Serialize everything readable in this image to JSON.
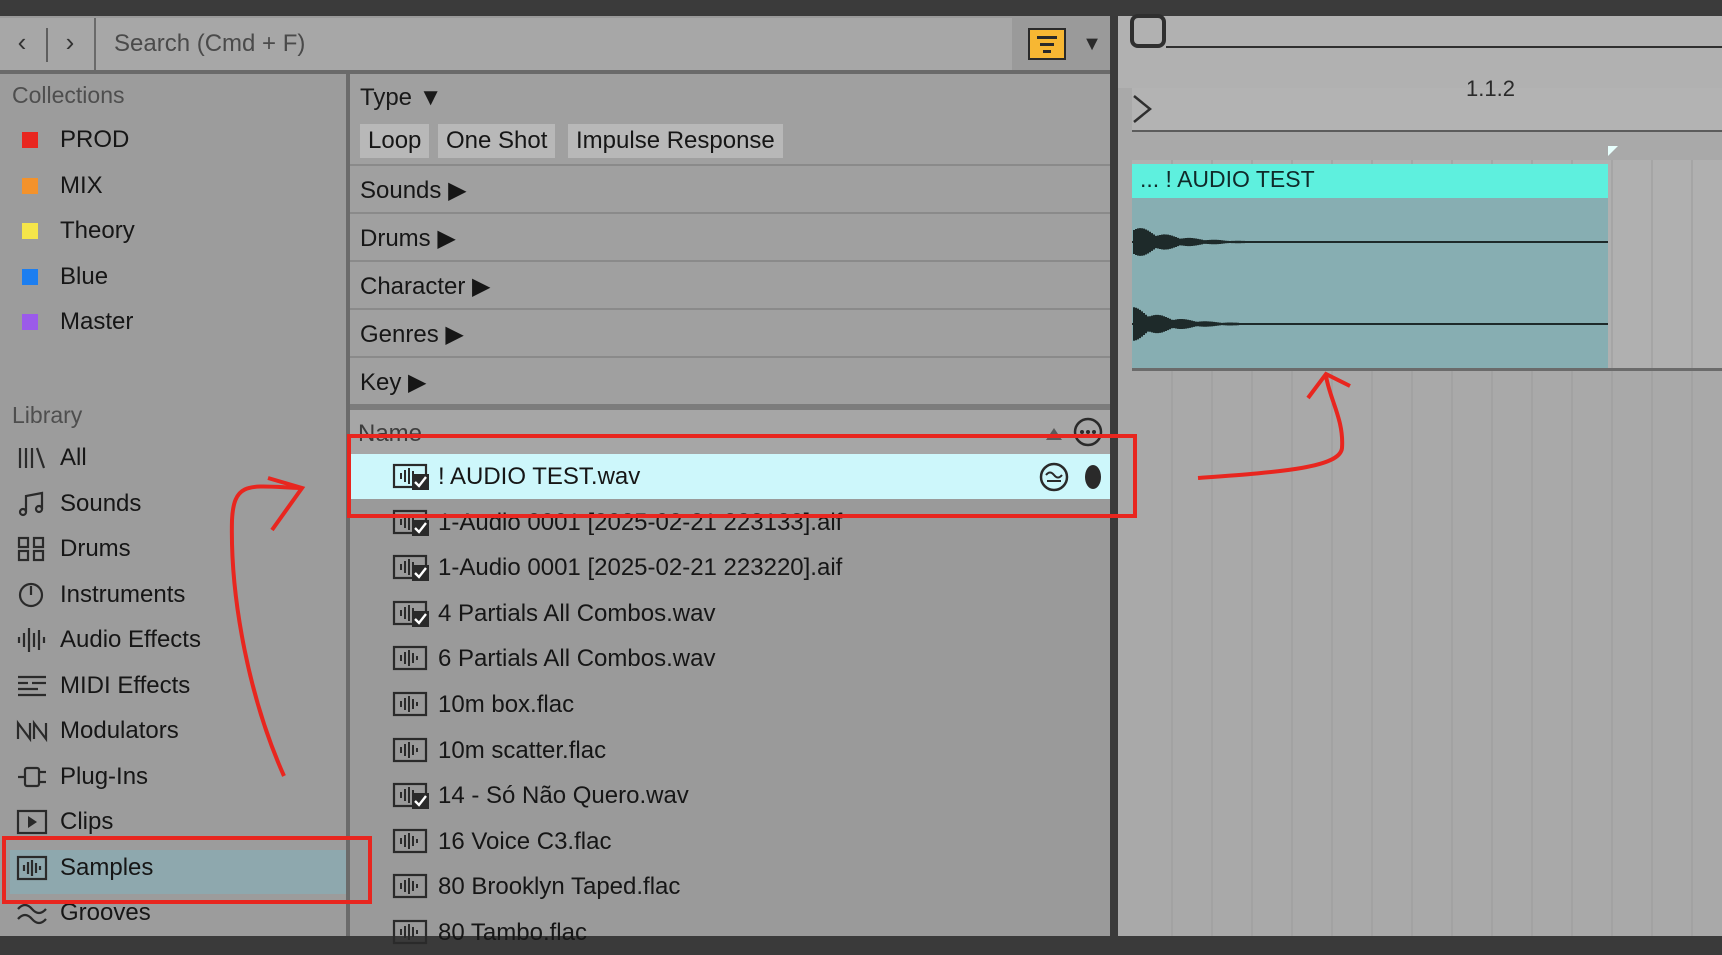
{
  "search": {
    "placeholder": "Search (Cmd + F)"
  },
  "nav": {
    "back": "‹",
    "forward": "›"
  },
  "collections": {
    "heading": "Collections",
    "items": [
      {
        "label": "PROD",
        "color": "#e8261f"
      },
      {
        "label": "MIX",
        "color": "#f3922b"
      },
      {
        "label": "Theory",
        "color": "#f5e54a"
      },
      {
        "label": "Blue",
        "color": "#1c7ef0"
      },
      {
        "label": "Master",
        "color": "#9b5bea"
      }
    ]
  },
  "library": {
    "heading": "Library",
    "items": [
      {
        "label": "All",
        "icon": "all-icon"
      },
      {
        "label": "Sounds",
        "icon": "music-note-icon"
      },
      {
        "label": "Drums",
        "icon": "drum-grid-icon"
      },
      {
        "label": "Instruments",
        "icon": "clock-icon"
      },
      {
        "label": "Audio Effects",
        "icon": "audio-effects-icon"
      },
      {
        "label": "MIDI Effects",
        "icon": "midi-effects-icon"
      },
      {
        "label": "Modulators",
        "icon": "modulators-icon"
      },
      {
        "label": "Plug-Ins",
        "icon": "plugin-icon"
      },
      {
        "label": "Clips",
        "icon": "clip-play-icon"
      },
      {
        "label": "Samples",
        "icon": "sample-icon",
        "selected": true
      },
      {
        "label": "Grooves",
        "icon": "groove-icon"
      }
    ]
  },
  "filters": {
    "type": {
      "label": "Type ▼",
      "tags": [
        "Loop",
        "One Shot",
        "Impulse Response"
      ]
    },
    "sections": [
      "Sounds ▶",
      "Drums ▶",
      "Character ▶",
      "Genres ▶",
      "Key ▶"
    ]
  },
  "list": {
    "header": "Name",
    "files": [
      {
        "name": "! AUDIO TEST.wav",
        "analyzed": true,
        "selected": true
      },
      {
        "name": "1-Audio 0001 [2025-02-21 223133].aif",
        "analyzed": true
      },
      {
        "name": "1-Audio 0001 [2025-02-21 223220].aif",
        "analyzed": true
      },
      {
        "name": "4 Partials All Combos.wav",
        "analyzed": true
      },
      {
        "name": "6 Partials All Combos.wav",
        "analyzed": false
      },
      {
        "name": "10m box.flac",
        "analyzed": false
      },
      {
        "name": "10m scatter.flac",
        "analyzed": false
      },
      {
        "name": "14 - Só Não Quero.wav",
        "analyzed": true
      },
      {
        "name": "16 Voice C3.flac",
        "analyzed": false
      },
      {
        "name": "80 Brooklyn Taped.flac",
        "analyzed": false
      },
      {
        "name": "80 Tambo.flac",
        "analyzed": false
      }
    ]
  },
  "arrangement": {
    "bar_label": "1.1.2",
    "clip_title": "... ! AUDIO TEST",
    "clip_color": "#5ef0de"
  },
  "annotation_color": "#e8261f"
}
